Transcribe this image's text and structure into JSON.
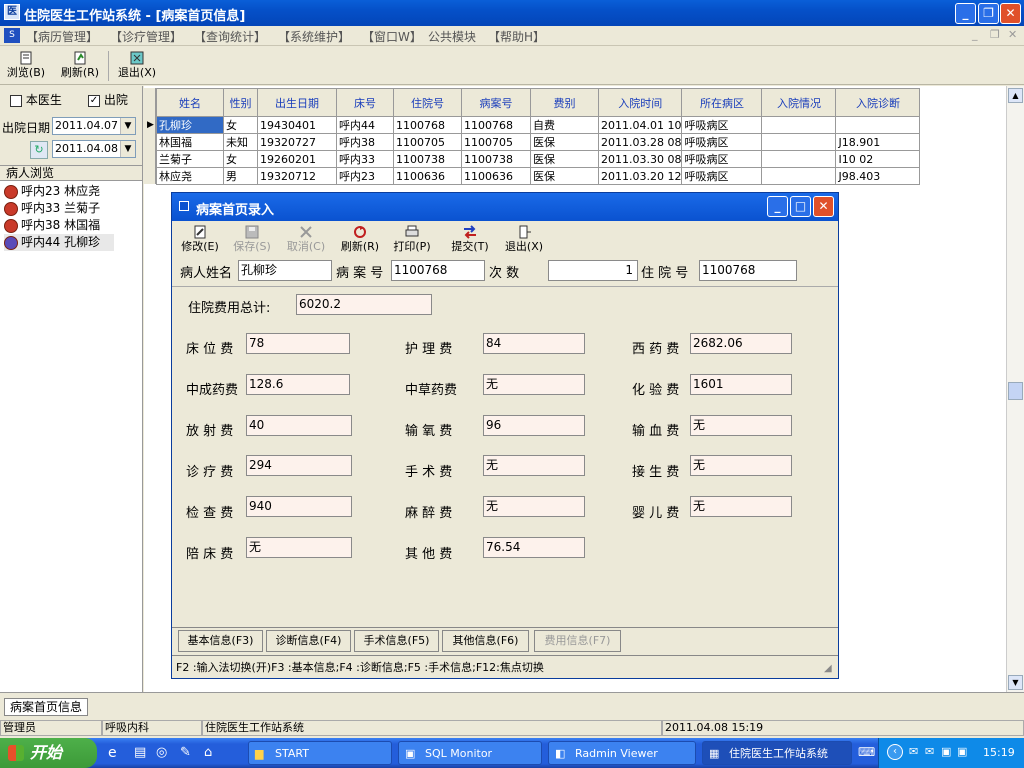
{
  "window": {
    "title": "住院医生工作站系统 - [病案首页信息]"
  },
  "menu": [
    "【病历管理】",
    "【诊疗管理】",
    "【查询统计】",
    "【系统维护】",
    "【窗口W】",
    "公共模块",
    "【帮助H】"
  ],
  "toolbar": {
    "browse": "浏览(B)",
    "refresh": "刷新(R)",
    "exit": "退出(X)"
  },
  "left": {
    "chk_doctor": "本医生",
    "chk_discharged": "出院",
    "discharge_date_label": "出院日期",
    "date1": "2011.04.07",
    "date2": "2011.04.08",
    "browse_header": "病人浏览",
    "patients": [
      "呼内23 林应尧",
      "呼内33 兰菊子",
      "呼内38 林国福",
      "呼内44 孔柳珍"
    ]
  },
  "table": {
    "headers": [
      "姓名",
      "性别",
      "出生日期",
      "床号",
      "住院号",
      "病案号",
      "费别",
      "入院时间",
      "所在病区",
      "入院情况",
      "入院诊断"
    ],
    "rows": [
      [
        "孔柳珍",
        "女",
        "19430401",
        "呼内44",
        "1100768",
        "1100768",
        "自费",
        "2011.04.01 10",
        "呼吸病区",
        "",
        ""
      ],
      [
        "林国福",
        "未知",
        "19320727",
        "呼内38",
        "1100705",
        "1100705",
        "医保",
        "2011.03.28 08",
        "呼吸病区",
        "",
        "J18.901"
      ],
      [
        "兰菊子",
        "女",
        "19260201",
        "呼内33",
        "1100738",
        "1100738",
        "医保",
        "2011.03.30 08",
        "呼吸病区",
        "",
        "I10   02"
      ],
      [
        "林应尧",
        "男",
        "19320712",
        "呼内23",
        "1100636",
        "1100636",
        "医保",
        "2011.03.20 12",
        "呼吸病区",
        "",
        "J98.403"
      ]
    ]
  },
  "dialog": {
    "title": "病案首页录入",
    "tools": [
      "修改(E)",
      "保存(S)",
      "取消(C)",
      "刷新(R)",
      "打印(P)",
      "提交(T)",
      "退出(X)"
    ],
    "patient_name_label": "病人姓名",
    "patient_name": "孔柳珍",
    "case_no_label": "病 案 号",
    "case_no": "1100768",
    "times_label": "次    数",
    "times": "1",
    "inpatient_no_label": "住 院 号",
    "inpatient_no": "1100768",
    "total_label": "住院费用总计:",
    "total": "6020.2",
    "fees": {
      "bed_label": "床 位 费",
      "bed": "78",
      "nursing_label": "护 理 费",
      "nursing": "84",
      "western_label": "西 药 费",
      "western": "2682.06",
      "patent_label": "中成药费",
      "patent": "128.6",
      "herbal_label": "中草药费",
      "herbal": "无",
      "lab_label": "化 验 费",
      "lab": "1601",
      "radiation_label": "放 射 费",
      "radiation": "40",
      "oxygen_label": "输 氧 费",
      "oxygen": "96",
      "blood_label": "输 血 费",
      "blood": "无",
      "treatment_label": "诊 疗 费",
      "treatment": "294",
      "surgery_label": "手 术 费",
      "surgery": "无",
      "delivery_label": "接 生 费",
      "delivery": "无",
      "exam_label": "检 查 费",
      "exam": "940",
      "anesthesia_label": "麻 醉 费",
      "anesthesia": "无",
      "infant_label": "婴 儿 费",
      "infant": "无",
      "escort_label": "陪 床 费",
      "escort": "无",
      "other_label": "其 他 费",
      "other": "76.54"
    },
    "tabs": [
      "基本信息(F3)",
      "诊断信息(F4)",
      "手术信息(F5)",
      "其他信息(F6)",
      "费用信息(F7)"
    ],
    "hint": "F2 :输入法切换(开)F3 :基本信息;F4 :诊断信息;F5 :手术信息;F12:焦点切换"
  },
  "bottom_tab": "病案首页信息",
  "status": {
    "user": "管理员",
    "dept": "呼吸内科",
    "app": "住院医生工作站系统",
    "datetime": "2011.04.08 15:19"
  },
  "taskbar": {
    "start": "开始",
    "tasks": [
      "START",
      "SQL Monitor",
      "Radmin Viewer",
      "住院医生工作站系统"
    ],
    "clock": "15:19"
  }
}
